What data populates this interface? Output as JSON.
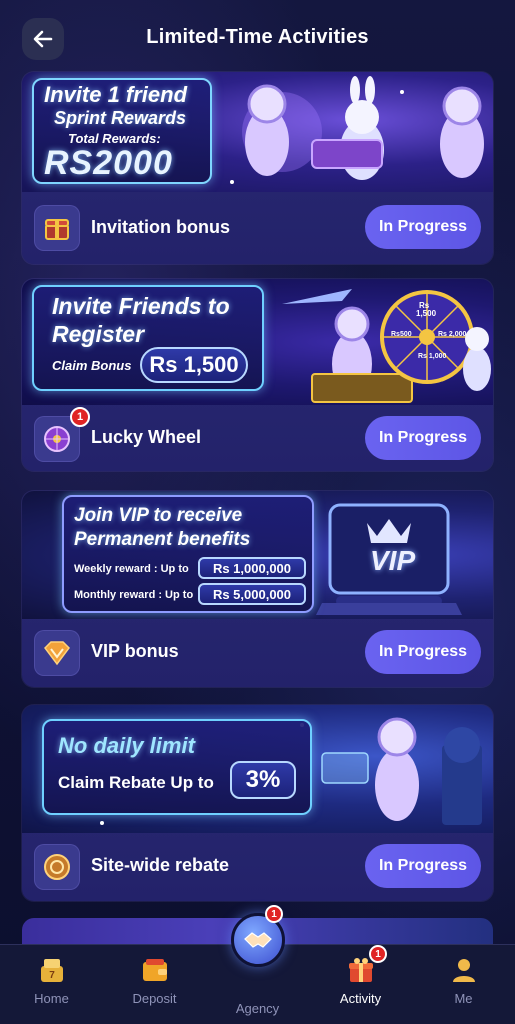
{
  "header": {
    "title": "Limited-Time Activities"
  },
  "activities": [
    {
      "name": "Invitation bonus",
      "status": "In Progress",
      "icon": "gift-chest-icon",
      "badge": "",
      "banner": {
        "line1": "Invite 1 friend",
        "line2": "Sprint Rewards",
        "line3": "Total Rewards:",
        "amount": "RS2000"
      }
    },
    {
      "name": "Lucky Wheel",
      "status": "In Progress",
      "icon": "wheel-icon",
      "badge": "1",
      "banner": {
        "line1": "Invite Friends to",
        "line2": "Register",
        "claim": "Claim Bonus",
        "amount": "Rs 1,500",
        "wheel_labels": [
          "Rs",
          "1,500",
          "Rs500",
          "Rs 2,000",
          "Rs 1,000"
        ]
      }
    },
    {
      "name": "VIP bonus",
      "status": "In Progress",
      "icon": "diamond-icon",
      "badge": "",
      "banner": {
        "line1": "Join VIP to receive",
        "line2": "Permanent benefits",
        "weekly_label": "Weekly reward : Up to",
        "weekly_value": "Rs 1,000,000",
        "monthly_label": "Monthly reward : Up to",
        "monthly_value": "Rs 5,000,000",
        "vip_text": "VIP"
      }
    },
    {
      "name": "Site-wide rebate",
      "status": "In Progress",
      "icon": "coin-icon",
      "badge": "",
      "banner": {
        "line1": "No daily limit",
        "line2": "Claim Rebate Up to",
        "amount": "3%"
      }
    }
  ],
  "nav": {
    "items": [
      {
        "label": "Home",
        "icon": "home-icon",
        "badge": ""
      },
      {
        "label": "Deposit",
        "icon": "wallet-icon",
        "badge": ""
      },
      {
        "label": "Agency",
        "icon": "handshake-icon",
        "badge": "1"
      },
      {
        "label": "Activity",
        "icon": "gift-icon",
        "badge": "1"
      },
      {
        "label": "Me",
        "icon": "person-icon",
        "badge": ""
      }
    ],
    "active": "Activity"
  },
  "colors": {
    "background": "#0f1236",
    "card": "#2a2a74",
    "button": "#6a63f0",
    "badge": "#e02424"
  }
}
